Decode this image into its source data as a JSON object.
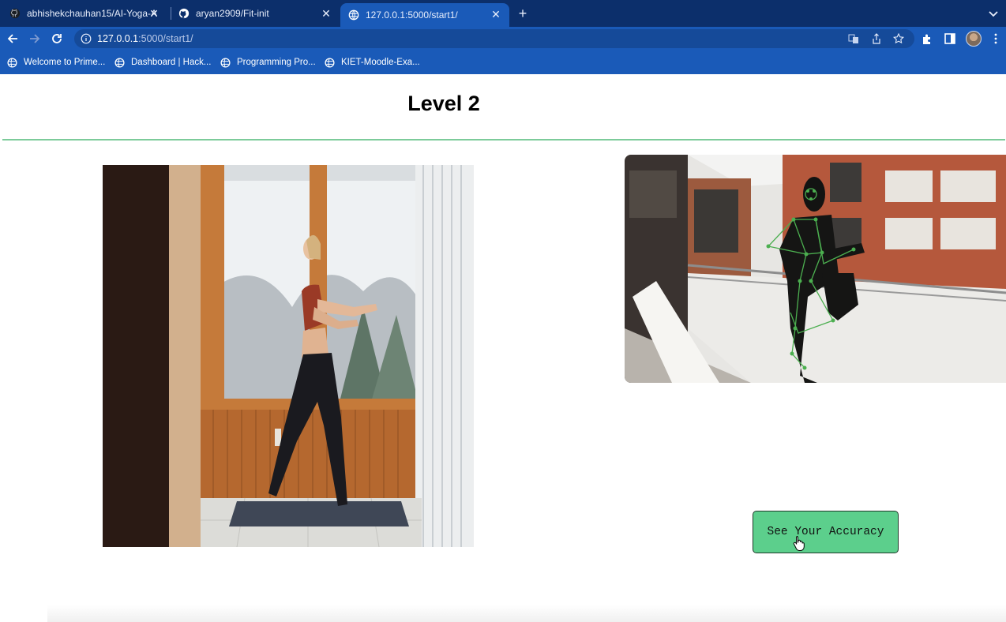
{
  "browser": {
    "tabs": [
      {
        "title": "abhishekchauhan15/AI-Yoga-A",
        "icon": "github-icon",
        "active": false
      },
      {
        "title": "aryan2909/Fit-init",
        "icon": "github-icon",
        "active": false
      },
      {
        "title": "127.0.0.1:5000/start1/",
        "icon": "globe-icon",
        "active": true
      }
    ],
    "url_host": "127.0.0.1",
    "url_rest": ":5000/start1/",
    "bookmarks": [
      {
        "label": "Welcome to Prime..."
      },
      {
        "label": "Dashboard | Hack..."
      },
      {
        "label": "Programming Pro..."
      },
      {
        "label": "KIET-Moodle-Exa..."
      }
    ]
  },
  "page": {
    "title": "Level 2",
    "button_label": "See Your Accuracy"
  },
  "colors": {
    "chrome_dark": "#0c2f6b",
    "chrome": "#1a5ab8",
    "divider": "#7ccb9a",
    "button": "#5ccf8c"
  }
}
